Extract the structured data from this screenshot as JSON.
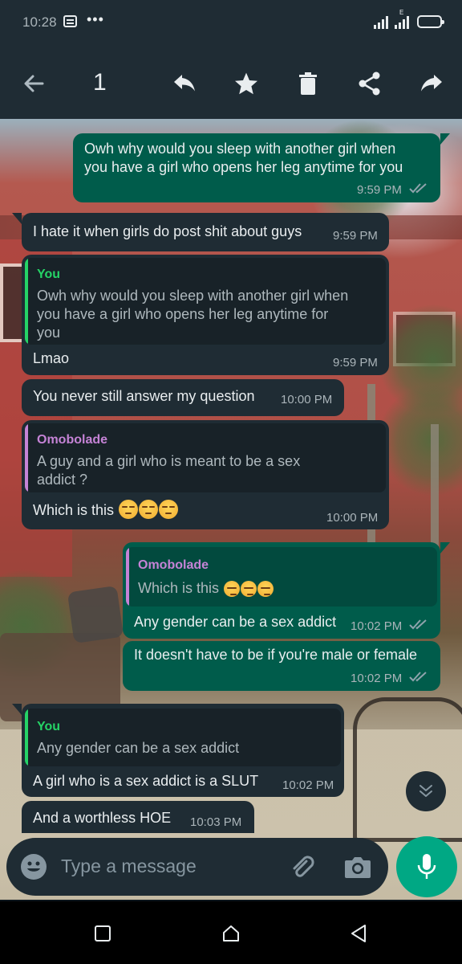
{
  "status_bar": {
    "time": "10:28",
    "network_label": "E"
  },
  "toolbar": {
    "selected_count": "1"
  },
  "messages": [
    {
      "id": "m0",
      "direction": "outgoing",
      "text_lines": [
        "Owh why would you sleep with another girl when",
        "you have a girl who opens her leg anytime for you"
      ],
      "time": "9:59 PM",
      "status": "read"
    },
    {
      "id": "m1",
      "direction": "incoming",
      "text": "I hate it when girls do post shit about guys",
      "time": "9:59 PM"
    },
    {
      "id": "m2",
      "direction": "incoming",
      "quote": {
        "author": "You",
        "text_lines": [
          "Owh why would you sleep with another girl when",
          "you have a girl who opens her leg anytime for",
          "you"
        ]
      },
      "text": "Lmao",
      "time": "9:59 PM"
    },
    {
      "id": "m3",
      "direction": "incoming",
      "text": "You never still answer my question",
      "time": "10:00 PM"
    },
    {
      "id": "m4",
      "direction": "incoming",
      "quote": {
        "author": "Omobolade",
        "text_lines": [
          "A guy and a girl who is meant to be a sex",
          "addict ?"
        ]
      },
      "text": "Which is this",
      "emoji": [
        "unamused",
        "unamused",
        "unamused"
      ],
      "time": "10:00 PM"
    },
    {
      "id": "m5",
      "direction": "outgoing",
      "quote": {
        "author": "Omobolade",
        "text": "Which is this",
        "emoji": [
          "unamused",
          "unamused",
          "unamused"
        ]
      },
      "text": "Any gender can be a sex addict",
      "time": "10:02 PM",
      "status": "read"
    },
    {
      "id": "m6",
      "direction": "outgoing",
      "text": "It doesn't have to be if you're male or female",
      "time": "10:02 PM",
      "status": "read"
    },
    {
      "id": "m7",
      "direction": "incoming",
      "quote": {
        "author": "You",
        "text": "Any gender can be a sex addict"
      },
      "text": "A girl who is a sex addict is a SLUT",
      "time": "10:02 PM"
    },
    {
      "id": "m8",
      "direction": "incoming",
      "text": "And a worthless HOE",
      "time": "10:03 PM"
    }
  ],
  "input": {
    "placeholder": "Type a message"
  },
  "colors": {
    "app_bar": "#1f2c34",
    "incoming_bubble": "#1f2c34",
    "outgoing_bubble": "#005c4b",
    "quote_incoming_bg": "#182228",
    "quote_outgoing_bg": "#024a3e",
    "quote_you_author": "#25d366",
    "quote_other_author": "#c583d6",
    "read_ticks": "#8fa3ac",
    "mic_button": "#00a884"
  },
  "icons": [
    "back-arrow-icon",
    "reply-icon",
    "star-icon",
    "delete-icon",
    "share-icon",
    "forward-icon",
    "emoji-icon",
    "attach-icon",
    "camera-icon",
    "mic-icon",
    "scroll-down-icon",
    "recents-icon",
    "home-icon",
    "back-nav-icon"
  ]
}
